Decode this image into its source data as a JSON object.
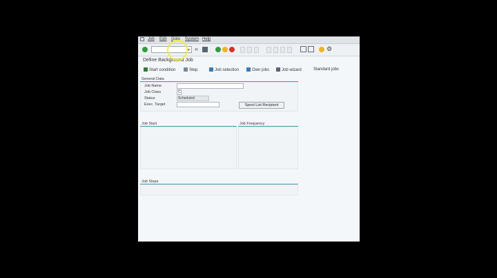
{
  "menu": {
    "items": [
      "Job",
      "Edit",
      "Goto",
      "System",
      "Help"
    ]
  },
  "toolbar": {
    "command_value": ""
  },
  "screen": {
    "title": "Define Background Job"
  },
  "app_toolbar": {
    "start_condition": "Start condition",
    "step": "Step",
    "job_selection": "Job selection",
    "own_jobs": "Own jobs",
    "job_wizard": "Job wizard",
    "standard_jobs": "Standard jobs"
  },
  "general_data": {
    "title": "General Data",
    "job_name_label": "Job Name",
    "job_name_value": "",
    "job_class_label": "Job Class",
    "job_class_value": "C",
    "status_label": "Status",
    "status_value": "Scheduled",
    "exec_target_label": "Exec. Target",
    "exec_target_value": "",
    "spool_button": "Spool List Recipient"
  },
  "job_start": {
    "title": "Job Start"
  },
  "job_frequency": {
    "title": "Job Frequency"
  },
  "job_steps": {
    "title": "Job Steps"
  },
  "colors": {
    "accent_line": "#3d9cb0",
    "enter_green": "#2e9e3a",
    "cancel_red": "#d9302c",
    "help_yellow": "#f2b21b"
  }
}
